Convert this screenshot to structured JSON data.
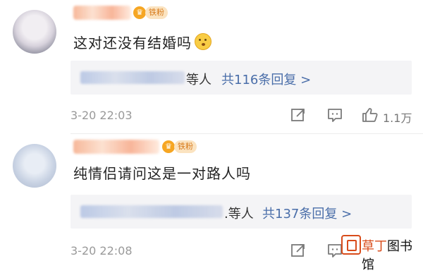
{
  "comments": [
    {
      "badge": "铁粉",
      "crown": "♛",
      "text": "这对还没有结婚吗",
      "emoji": "hushed-face-emoji",
      "reply_others": "等人",
      "reply_link": "共116条回复 >",
      "time": "3-20 22:03",
      "like_count": "1.1万"
    },
    {
      "badge": "铁粉",
      "crown": "♛",
      "text": "纯情侣请问这是一对路人吗",
      "reply_others": ".等人",
      "reply_link": "共137条回复 >",
      "time": "3-20 22:08"
    }
  ],
  "watermark": {
    "brand_highlight": "草丁",
    "brand_rest": "图书馆"
  },
  "colors": {
    "link": "#4a6ea9",
    "badge_bg": "#fbe3c0",
    "badge_text": "#d77a1a",
    "accent": "#d84c1b"
  }
}
